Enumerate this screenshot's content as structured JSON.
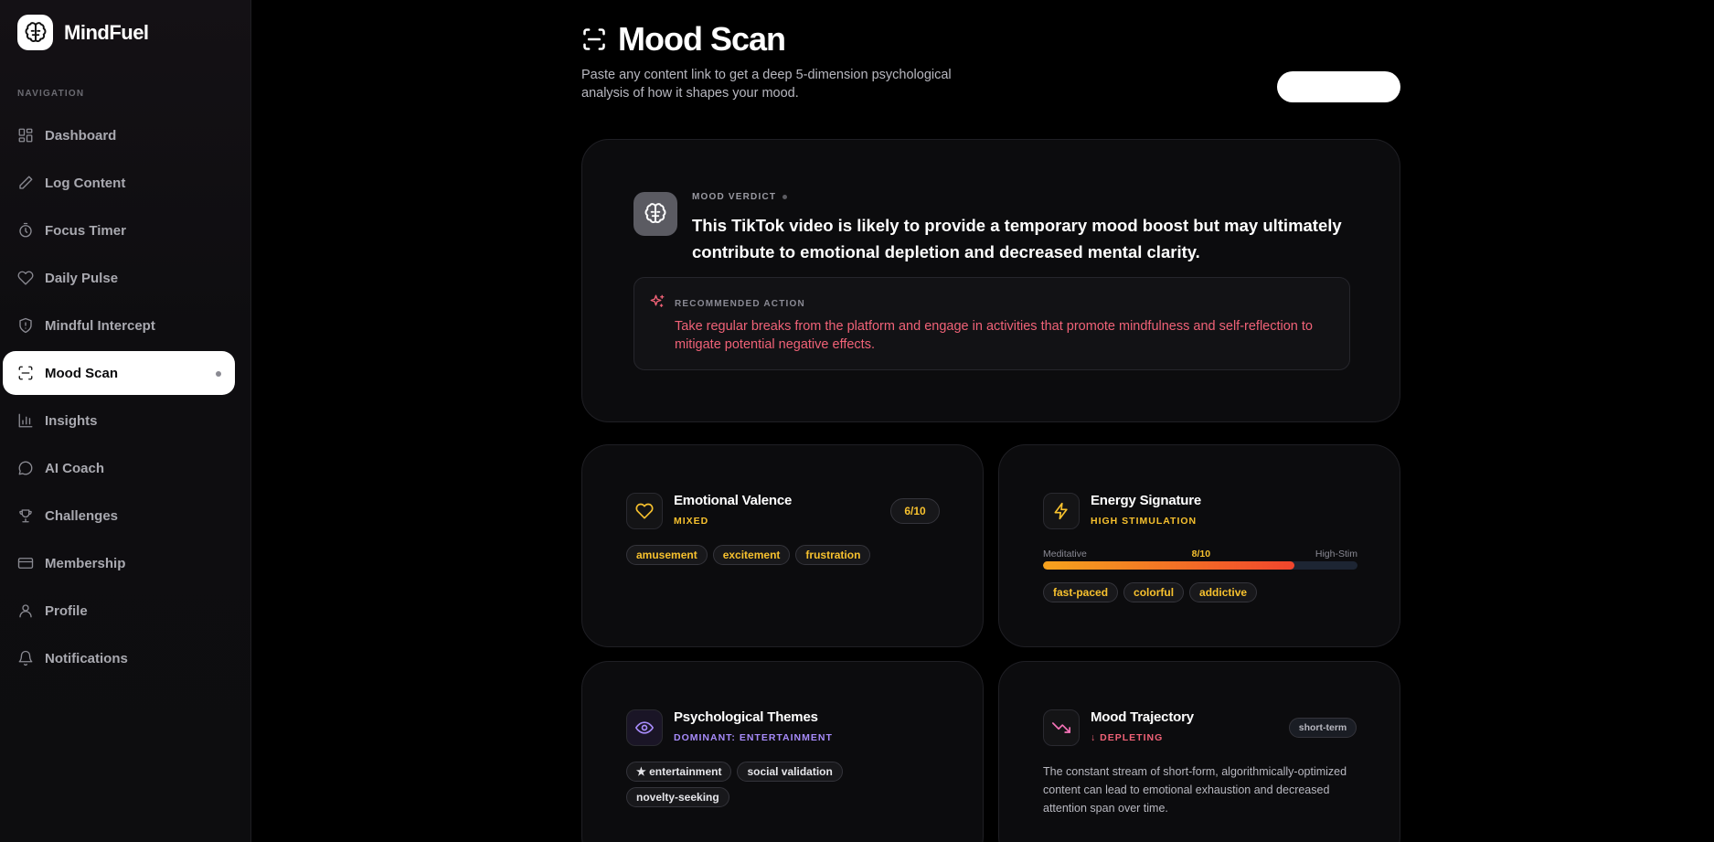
{
  "app": {
    "name": "MindFuel"
  },
  "sidebar": {
    "heading": "NAVIGATION",
    "items": [
      {
        "label": "Dashboard",
        "icon": "grid-icon"
      },
      {
        "label": "Log Content",
        "icon": "pencil-icon"
      },
      {
        "label": "Focus Timer",
        "icon": "timer-icon"
      },
      {
        "label": "Daily Pulse",
        "icon": "heart-icon"
      },
      {
        "label": "Mindful Intercept",
        "icon": "shield-icon"
      },
      {
        "label": "Mood Scan",
        "icon": "scan-icon",
        "active": true
      },
      {
        "label": "Insights",
        "icon": "bar-chart-icon"
      },
      {
        "label": "AI Coach",
        "icon": "chat-icon"
      },
      {
        "label": "Challenges",
        "icon": "trophy-icon"
      },
      {
        "label": "Membership",
        "icon": "credit-card-icon"
      },
      {
        "label": "Profile",
        "icon": "user-icon"
      },
      {
        "label": "Notifications",
        "icon": "bell-icon"
      }
    ]
  },
  "header": {
    "title": "Mood Scan",
    "subtitle": "Paste any content link to get a deep 5-dimension psychological analysis of how it shapes your mood."
  },
  "verdict": {
    "label": "MOOD VERDICT",
    "text": "This TikTok video is likely to provide a temporary mood boost but may ultimately contribute to emotional depletion and decreased mental clarity.",
    "action_label": "RECOMMENDED ACTION",
    "action_text": "Take regular breaks from the platform and engage in activities that promote mindfulness and self-reflection to mitigate potential negative effects."
  },
  "valence": {
    "title": "Emotional Valence",
    "subtitle": "MIXED",
    "score": "6/10",
    "tags": [
      "amusement",
      "excitement",
      "frustration"
    ]
  },
  "energy": {
    "title": "Energy Signature",
    "subtitle": "HIGH STIMULATION",
    "scale_min": "Meditative",
    "scale_value": "8/10",
    "scale_max": "High-Stim",
    "level": 0.8,
    "tags": [
      "fast-paced",
      "colorful",
      "addictive"
    ]
  },
  "themes": {
    "title": "Psychological Themes",
    "subtitle": "DOMINANT: ENTERTAINMENT",
    "tags": [
      "★ entertainment",
      "social validation",
      "novelty-seeking"
    ]
  },
  "trajectory": {
    "title": "Mood Trajectory",
    "subtitle": "↓ DEPLETING",
    "badge": "short-term",
    "text": "The constant stream of short-form, algorithmically-optimized content can lead to emotional exhaustion and decreased attention span over time."
  },
  "colors": {
    "accent_yellow": "#f7c12e",
    "accent_red": "#f06277",
    "accent_purple": "#a78bfa",
    "accent_pink": "#f472b6"
  }
}
